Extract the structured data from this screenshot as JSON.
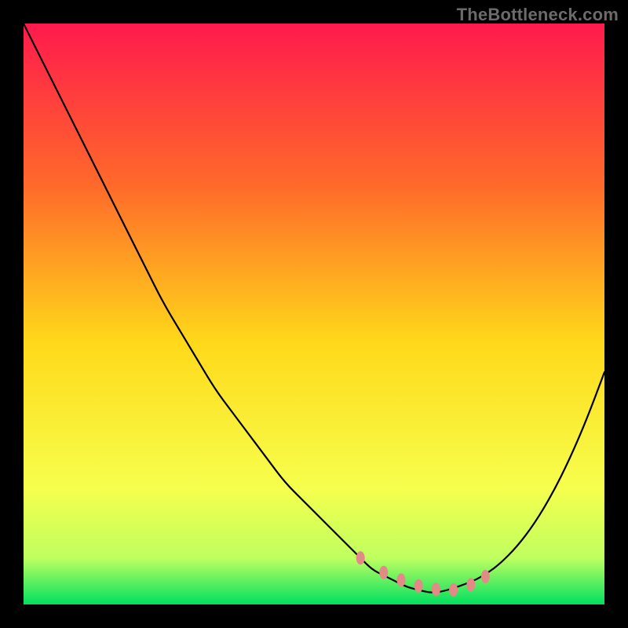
{
  "watermark": "TheBottleneck.com",
  "chart_data": {
    "type": "line",
    "title": "",
    "xlabel": "",
    "ylabel": "",
    "xlim": [
      0,
      100
    ],
    "ylim": [
      0,
      100
    ],
    "grid": false,
    "legend": false,
    "background_gradient": {
      "top": "#ff1a4d",
      "mid_upper": "#ff8030",
      "mid": "#ffd91a",
      "mid_lower": "#f6ff4d",
      "bottom": "#00e060"
    },
    "curve_color": "#000000",
    "marker_color": "#e28a86",
    "x": [
      0,
      3,
      6,
      9,
      12,
      15,
      18,
      21,
      24,
      27,
      30,
      33,
      36,
      39,
      42,
      45,
      48,
      51,
      54,
      56,
      58,
      60,
      62,
      64,
      66,
      68,
      70,
      72,
      74,
      76,
      78,
      80,
      82,
      85,
      88,
      91,
      94,
      97,
      100
    ],
    "y": [
      100,
      94,
      88,
      82,
      76,
      70,
      64,
      58,
      52,
      47,
      42,
      37,
      33,
      29,
      25,
      21,
      18,
      15,
      12,
      10,
      8,
      6,
      5,
      4,
      3,
      2.5,
      2,
      2.2,
      2.8,
      3.5,
      4.3,
      5.5,
      7,
      10,
      14,
      19,
      25,
      32,
      40
    ],
    "markers": [
      {
        "x": 58,
        "y": 8
      },
      {
        "x": 62,
        "y": 5.5
      },
      {
        "x": 65,
        "y": 4.2
      },
      {
        "x": 68,
        "y": 3.2
      },
      {
        "x": 71,
        "y": 2.6
      },
      {
        "x": 74,
        "y": 2.5
      },
      {
        "x": 77,
        "y": 3.4
      },
      {
        "x": 79.5,
        "y": 4.8
      }
    ]
  }
}
